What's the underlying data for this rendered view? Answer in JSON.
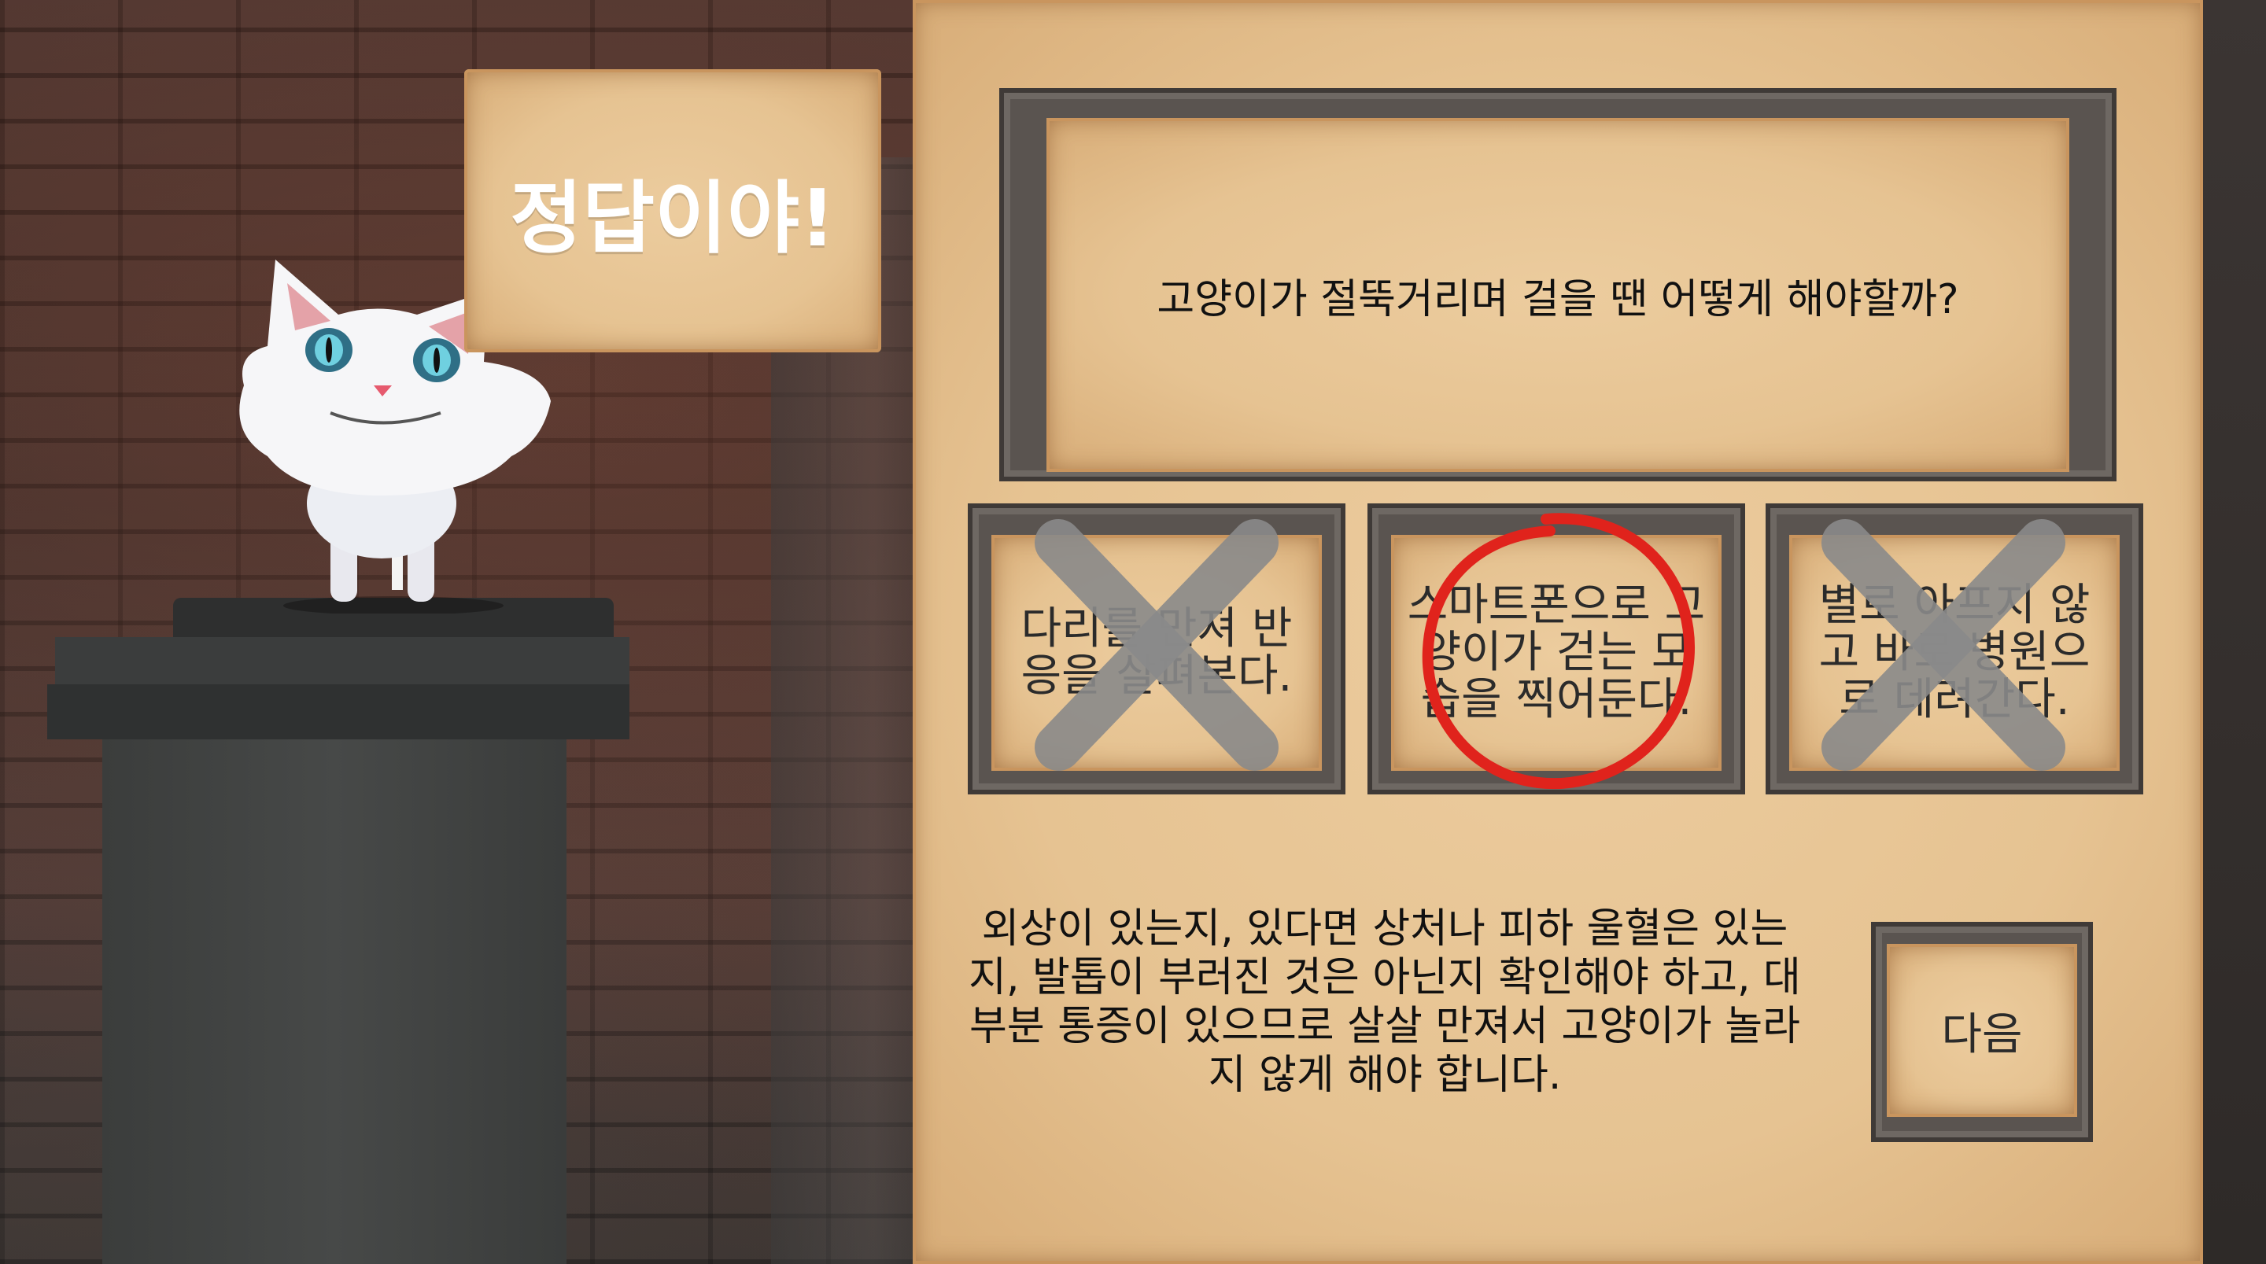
{
  "feedback": {
    "title": "정답이야!"
  },
  "question": {
    "text": "고양이가 절뚝거리며 걸을 땐 어떻게 해야할까?"
  },
  "answers": [
    {
      "label": "다리를 만져 반응을 살펴본다.",
      "status": "wrong",
      "mark": "x-icon"
    },
    {
      "label": "스마트폰으로 고양이가 걷는 모습을 찍어둔다.",
      "status": "correct",
      "mark": "circle-icon"
    },
    {
      "label": "별로 아프지 않고 바로 병원으로 데려간다.",
      "status": "wrong",
      "mark": "x-icon"
    }
  ],
  "explanation": {
    "text": "외상이 있는지, 있다면 상처나 피하 울혈은 있는지, 발톱이 부러진 것은 아닌지 확인해야 하고, 대부분 통증이 있으므로 살살 만져서 고양이가 놀라지 않게 해야 합니다."
  },
  "buttons": {
    "next_label": "다음"
  },
  "colors": {
    "parchment": "#e6c392",
    "frame": "#5a5450",
    "correct_mark": "#e0231c",
    "wrong_mark": "#8a8a8a",
    "title_text": "#ffffff"
  }
}
